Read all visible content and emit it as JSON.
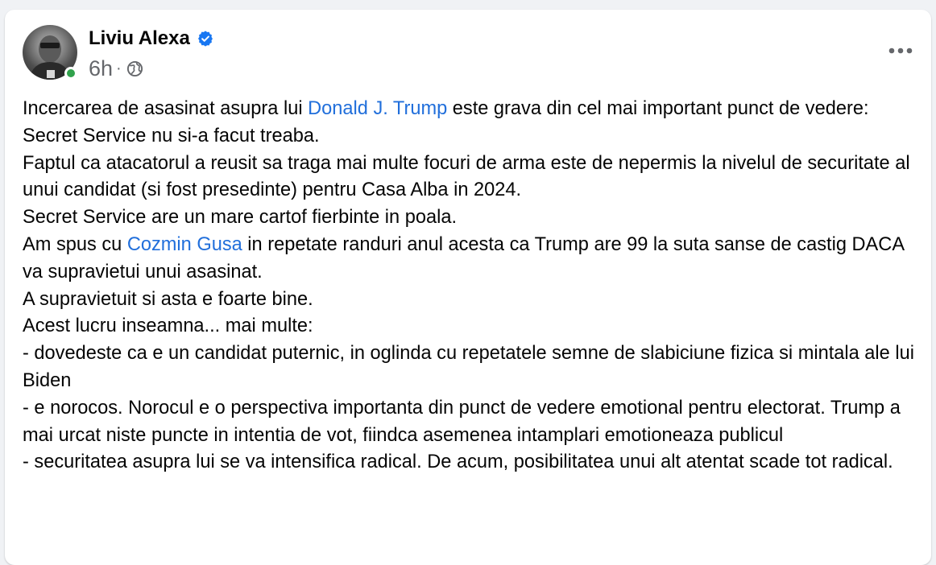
{
  "post": {
    "author": "Liviu Alexa",
    "timestamp": "6h",
    "separator": "·",
    "verified_icon": "verified-badge-icon",
    "audience_icon": "globe-icon",
    "more_icon": "more-options-icon",
    "colors": {
      "mention": "#216fdb",
      "online": "#31a24c",
      "verified": "#1877f2",
      "secondary_text": "#65676b"
    },
    "paragraphs": [
      {
        "pre": "Incercarea de asasinat asupra lui ",
        "mention": "Donald J. Trump",
        "post": " este grava din cel mai important punct de vedere: Secret Service nu si-a facut treaba."
      },
      {
        "text": "Faptul ca atacatorul a reusit sa traga mai multe focuri de arma este de nepermis la nivelul de securitate al unui candidat (si fost presedinte) pentru Casa Alba in 2024."
      },
      {
        "text": "Secret Service are un mare cartof fierbinte in poala."
      },
      {
        "pre": "Am spus cu ",
        "mention": "Cozmin Gusa",
        "post": " in repetate randuri anul acesta ca Trump are 99 la suta sanse de castig DACA va supravietui unui asasinat."
      },
      {
        "text": "A supravietuit si asta e foarte bine."
      },
      {
        "text": "Acest lucru inseamna... mai multe:"
      },
      {
        "text": "- dovedeste ca e un candidat puternic, in oglinda cu repetatele semne de slabiciune fizica si mintala ale lui Biden"
      },
      {
        "text": "- e norocos. Norocul e o perspectiva importanta din punct de vedere emotional pentru electorat. Trump a mai urcat niste puncte in intentia de vot, fiindca asemenea intamplari emotioneaza publicul"
      },
      {
        "text": "- securitatea asupra lui se va intensifica radical. De acum, posibilitatea unui alt atentat scade tot radical."
      }
    ]
  }
}
